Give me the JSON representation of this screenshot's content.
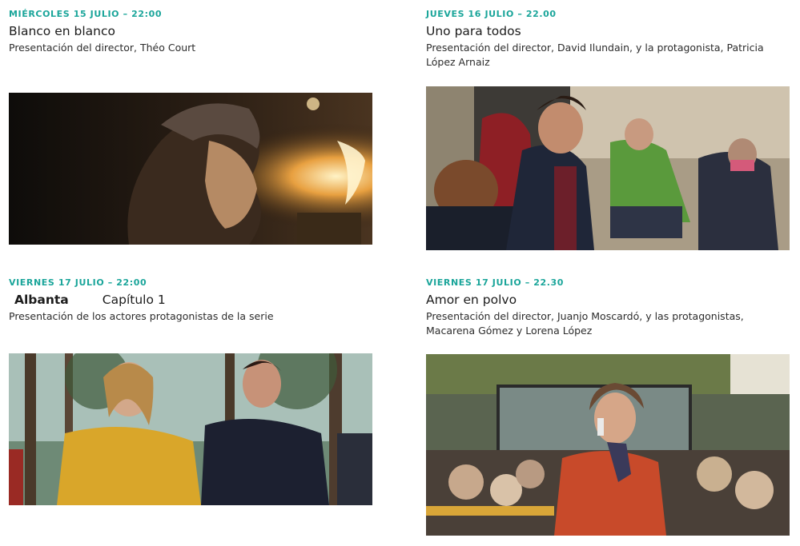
{
  "events": [
    {
      "date": "MIÉRCOLES 15 JULIO – 22:00",
      "title": "Blanco en blanco",
      "description": "Presentación del director, Théo Court",
      "image": "film-still-blanco-en-blanco"
    },
    {
      "date": "JUEVES 16 JULIO – 22.00",
      "title": "Uno para todos",
      "description": "Presentación del director, David Ilundain, y la protagonista, Patricia López Arnaiz",
      "image": "film-still-uno-para-todos"
    },
    {
      "date": "VIERNES 17 JULIO – 22:00",
      "title_series": "Albanta",
      "title_chapter": "Capítulo 1",
      "description": "Presentación de los actores protagonistas de la serie",
      "image": "film-still-albanta"
    },
    {
      "date": "VIERNES 17 JULIO – 22.30",
      "title": "Amor en polvo",
      "description": "Presentación del director, Juanjo Moscardó, y las protagonistas, Macarena Gómez y Lorena López",
      "image": "film-still-amor-en-polvo"
    }
  ],
  "colors": {
    "accent": "#1aa59a",
    "text": "#1c1c1c",
    "background": "#ffffff"
  }
}
